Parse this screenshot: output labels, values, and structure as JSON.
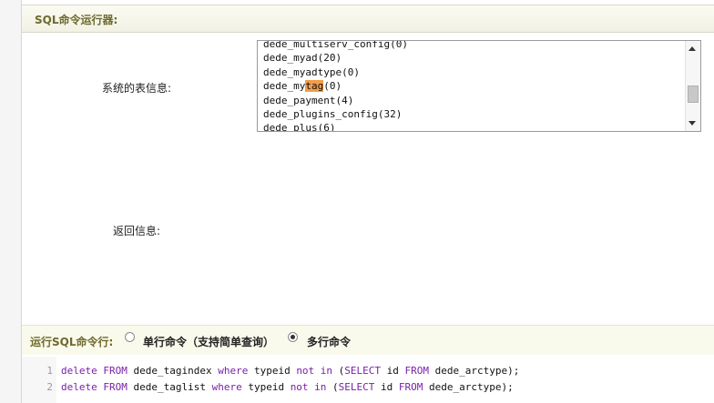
{
  "header": {
    "title": "SQL命令运行器:"
  },
  "labels": {
    "tables_info": "系统的表信息:",
    "return_info": "返回信息:"
  },
  "table_list": {
    "items": [
      {
        "pre": "dede_multiserv_config(0)",
        "hl": "",
        "post": ""
      },
      {
        "pre": "dede_myad(20)",
        "hl": "",
        "post": ""
      },
      {
        "pre": "dede_myadtype(0)",
        "hl": "",
        "post": ""
      },
      {
        "pre": "dede_my",
        "hl": "tag",
        "post": "(0)"
      },
      {
        "pre": "dede_payment(4)",
        "hl": "",
        "post": ""
      },
      {
        "pre": "dede_plugins_config(32)",
        "hl": "",
        "post": ""
      },
      {
        "pre": "dede_plus(6)",
        "hl": "",
        "post": ""
      }
    ]
  },
  "command_bar": {
    "label": "运行SQL命令行:",
    "single_label": "单行命令（支持简单查询）",
    "multi_label": "多行命令",
    "selected": "multi"
  },
  "editor": {
    "lines": [
      {
        "no": "1",
        "parts": [
          {
            "t": "delete ",
            "c": "kw"
          },
          {
            "t": "FROM ",
            "c": "kw"
          },
          {
            "t": "dede_tagindex ",
            "c": ""
          },
          {
            "t": "where ",
            "c": "kw"
          },
          {
            "t": "typeid ",
            "c": ""
          },
          {
            "t": "not in ",
            "c": "kw"
          },
          {
            "t": "(",
            "c": ""
          },
          {
            "t": "SELECT ",
            "c": "kw"
          },
          {
            "t": "id ",
            "c": ""
          },
          {
            "t": "FROM ",
            "c": "kw"
          },
          {
            "t": "dede_arctype);",
            "c": ""
          }
        ]
      },
      {
        "no": "2",
        "parts": [
          {
            "t": "delete ",
            "c": "kw"
          },
          {
            "t": "FROM ",
            "c": "kw"
          },
          {
            "t": "dede_taglist ",
            "c": ""
          },
          {
            "t": "where ",
            "c": "kw"
          },
          {
            "t": "typeid ",
            "c": ""
          },
          {
            "t": "not in ",
            "c": "kw"
          },
          {
            "t": "(",
            "c": ""
          },
          {
            "t": "SELECT ",
            "c": "kw"
          },
          {
            "t": "id ",
            "c": ""
          },
          {
            "t": "FROM ",
            "c": "kw"
          },
          {
            "t": "dede_arctype);",
            "c": ""
          }
        ]
      }
    ]
  }
}
